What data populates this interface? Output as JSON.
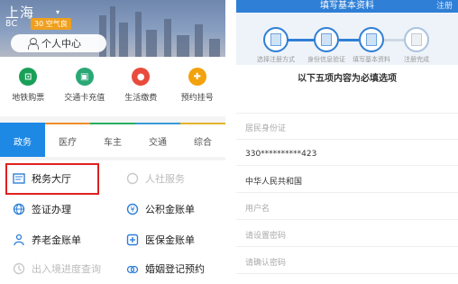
{
  "left_app": {
    "header": {
      "city": "上海",
      "weather": "8C",
      "aqi_badge": "30 空气良",
      "profile_button": "个人中心"
    },
    "quick_actions": [
      {
        "label": "地铁购票",
        "icon": "metro-ticket-icon",
        "color": "#19a058",
        "glyph": "地"
      },
      {
        "label": "交通卡充值",
        "icon": "transit-card-icon",
        "color": "#2aa875",
        "glyph": "卡"
      },
      {
        "label": "生活缴费",
        "icon": "utility-payment-icon",
        "color": "#e84b3c",
        "glyph": "缴"
      },
      {
        "label": "预约挂号",
        "icon": "appointment-icon",
        "color": "#f2a20c",
        "glyph": "约"
      }
    ],
    "tabs": [
      {
        "label": "政务",
        "active": true
      },
      {
        "label": "医疗",
        "active": false
      },
      {
        "label": "车主",
        "active": false
      },
      {
        "label": "交通",
        "active": false
      },
      {
        "label": "综合",
        "active": false
      }
    ],
    "services": [
      {
        "label": "税务大厅",
        "icon": "tax-hall-icon",
        "faded": false,
        "highlighted": true
      },
      {
        "label": "人社服务",
        "icon": "social-security-icon",
        "faded": true,
        "highlighted": false
      },
      {
        "label": "签证办理",
        "icon": "visa-icon",
        "faded": false,
        "highlighted": false
      },
      {
        "label": "公积金账单",
        "icon": "housing-fund-icon",
        "faded": false,
        "highlighted": false
      },
      {
        "label": "养老金账单",
        "icon": "pension-icon",
        "faded": false,
        "highlighted": false
      },
      {
        "label": "医保金账单",
        "icon": "medical-insurance-icon",
        "faded": false,
        "highlighted": false
      },
      {
        "label": "出入境进度查询",
        "icon": "immigration-icon",
        "faded": true,
        "highlighted": false
      },
      {
        "label": "婚姻登记预约",
        "icon": "marriage-icon",
        "faded": false,
        "highlighted": false
      }
    ],
    "colors": {
      "accent": "#1e88e5",
      "highlight_border": "#e02020"
    }
  },
  "right_app": {
    "nav": {
      "title": "填写基本资料",
      "action": "注册"
    },
    "steps": [
      {
        "label": "选择注册方式",
        "active": true
      },
      {
        "label": "身份信息验证",
        "active": true
      },
      {
        "label": "填写基本资料",
        "active": true
      },
      {
        "label": "注册完成",
        "active": false
      }
    ],
    "required_note": "以下五项内容为必填选项",
    "fields": [
      {
        "text": "",
        "kind": "placeholder",
        "name": "real-name-field"
      },
      {
        "text": "居民身份证",
        "kind": "placeholder",
        "name": "id-type-field"
      },
      {
        "text": "330**********423",
        "kind": "value",
        "name": "id-number-field"
      },
      {
        "text": "中华人民共和国",
        "kind": "value",
        "name": "nationality-field"
      },
      {
        "text": "用户名",
        "kind": "placeholder",
        "name": "username-field"
      },
      {
        "text": "请设置密码",
        "kind": "placeholder",
        "name": "password-field"
      },
      {
        "text": "请确认密码",
        "kind": "placeholder",
        "name": "confirm-password-field"
      }
    ],
    "colors": {
      "nav": "#2f7fd6"
    }
  }
}
